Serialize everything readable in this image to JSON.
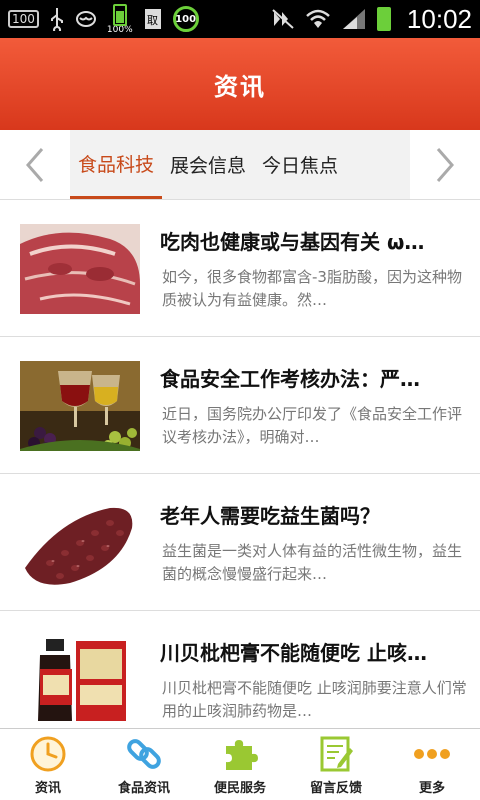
{
  "status_bar": {
    "left_badge": "100",
    "battery_small_label": "100%",
    "circle_badge": "100",
    "time": "10:02"
  },
  "header": {
    "title": "资讯"
  },
  "tabs": [
    {
      "label": "食品科技",
      "active": true
    },
    {
      "label": "展会信息",
      "active": false
    },
    {
      "label": "今日焦点",
      "active": false
    }
  ],
  "articles": [
    {
      "title": "吃肉也健康或与基因有关 ω…",
      "desc": "如今，很多食物都富含-3脂肪酸，因为这种物质被认为有益健康。然…",
      "thumb": "meat-image"
    },
    {
      "title": "食品安全工作考核办法：严…",
      "desc": "近日，国务院办公厅印发了《食品安全工作评议考核办法》，明确对…",
      "thumb": "wine-image"
    },
    {
      "title": "老年人需要吃益生菌吗？",
      "desc": "益生菌是一类对人体有益的活性微生物，益生菌的概念慢慢盛行起来…",
      "thumb": "beans-image"
    },
    {
      "title": "川贝枇杷膏不能随便吃 止咳…",
      "desc": "川贝枇杷膏不能随便吃 止咳润肺要注意人们常用的止咳润肺药物是…",
      "thumb": "syrup-image"
    }
  ],
  "bottom_nav": [
    {
      "label": "资讯",
      "icon": "clock-icon"
    },
    {
      "label": "食品资讯",
      "icon": "link-icon"
    },
    {
      "label": "便民服务",
      "icon": "puzzle-icon"
    },
    {
      "label": "留言反馈",
      "icon": "edit-note-icon"
    },
    {
      "label": "更多",
      "icon": "more-dots-icon"
    }
  ],
  "colors": {
    "header_red": "#e04a2a",
    "tab_active": "#c84a1a",
    "nav_icon_green": "#9ac832",
    "nav_icon_blue": "#3fa3e0",
    "nav_icon_orange": "#f0a020"
  }
}
